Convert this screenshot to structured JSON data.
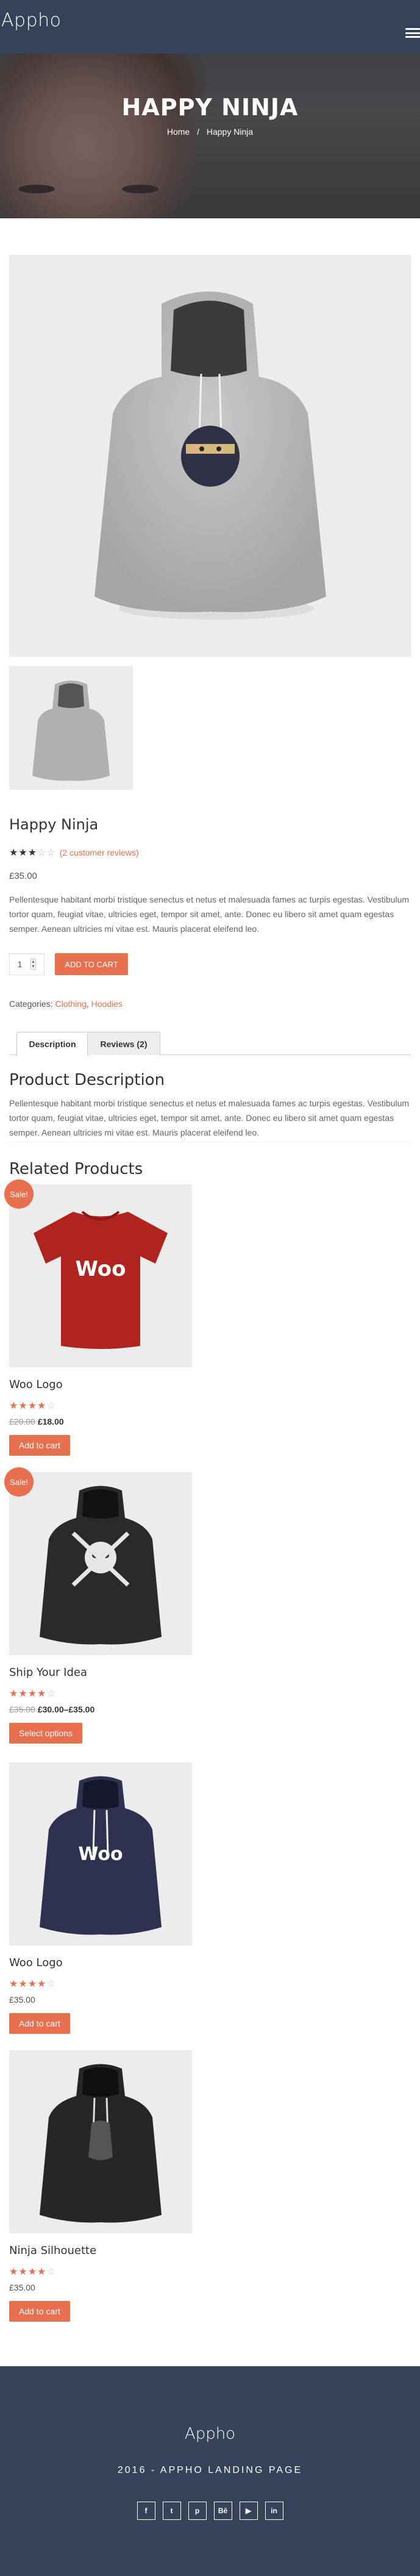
{
  "header": {
    "brand": "Appho",
    "menu_icon": "hamburger-icon"
  },
  "hero": {
    "title": "HAPPY NINJA",
    "breadcrumb": {
      "home": "Home",
      "separator": "/",
      "current": "Happy Ninja"
    }
  },
  "product": {
    "title": "Happy Ninja",
    "rating": 3,
    "rating_max": 5,
    "stars_text": "★★★",
    "stars_off_text": "☆☆",
    "reviews_link": "(2 customer reviews)",
    "price": "£35.00",
    "short_description": "Pellentesque habitant morbi tristique senectus et netus et malesuada fames ac turpis egestas. Vestibulum tortor quam, feugiat vitae, ultricies eget, tempor sit amet, ante. Donec eu libero sit amet quam egestas semper. Aenean ultricies mi vitae est. Mauris placerat eleifend leo.",
    "quantity": "1",
    "add_to_cart": "ADD TO CART",
    "categories_label": "Categories:",
    "categories": [
      "Clothing",
      "Hoodies"
    ],
    "categories_sep": ","
  },
  "tabs": [
    {
      "label": "Description",
      "active": true
    },
    {
      "label": "Reviews (2)",
      "active": false
    }
  ],
  "description": {
    "title": "Product Description",
    "text": "Pellentesque habitant morbi tristique senectus et netus et malesuada fames ac turpis egestas. Vestibulum tortor quam, feugiat vitae, ultricies eget, tempor sit amet, ante. Donec eu libero sit amet quam egestas semper. Aenean ultricies mi vitae est. Mauris placerat eleifend leo."
  },
  "related": {
    "title": "Related Products",
    "items": [
      {
        "name": "Woo Logo",
        "sale": "Sale!",
        "rating": 4,
        "stars_text": "★★★★",
        "stars_off_text": "☆",
        "old_price": "£20.00",
        "price": "£18.00",
        "button": "Add to cart",
        "image": "tshirt-red-woo"
      },
      {
        "name": "Ship Your Idea",
        "sale": "Sale!",
        "rating": 4,
        "stars_text": "★★★★",
        "stars_off_text": "☆",
        "old_price": "£35.00",
        "price": "£30.00–£35.00",
        "button": "Select options",
        "image": "hoodie-black-skull"
      },
      {
        "name": "Woo Logo",
        "sale": "",
        "rating": 4,
        "stars_text": "★★★★",
        "stars_off_text": "☆",
        "old_price": "",
        "price": "£35.00",
        "button": "Add to cart",
        "image": "hoodie-navy-woo"
      },
      {
        "name": "Ninja Silhouette",
        "sale": "",
        "rating": 4,
        "stars_text": "★★★★",
        "stars_off_text": "☆",
        "old_price": "",
        "price": "£35.00",
        "button": "Add to cart",
        "image": "hoodie-black-ninja"
      }
    ]
  },
  "footer": {
    "brand": "Appho",
    "text": "2016 - APPHO LANDING PAGE",
    "social": [
      {
        "name": "facebook-icon",
        "glyph": "f"
      },
      {
        "name": "twitter-icon",
        "glyph": "t"
      },
      {
        "name": "pinterest-icon",
        "glyph": "p"
      },
      {
        "name": "behance-icon",
        "glyph": "Bē"
      },
      {
        "name": "youtube-icon",
        "glyph": "▶"
      },
      {
        "name": "linkedin-icon",
        "glyph": "in"
      }
    ]
  },
  "colors": {
    "accent": "#e8704f",
    "header_bg": "#34435a",
    "image_bg": "#ececec"
  }
}
